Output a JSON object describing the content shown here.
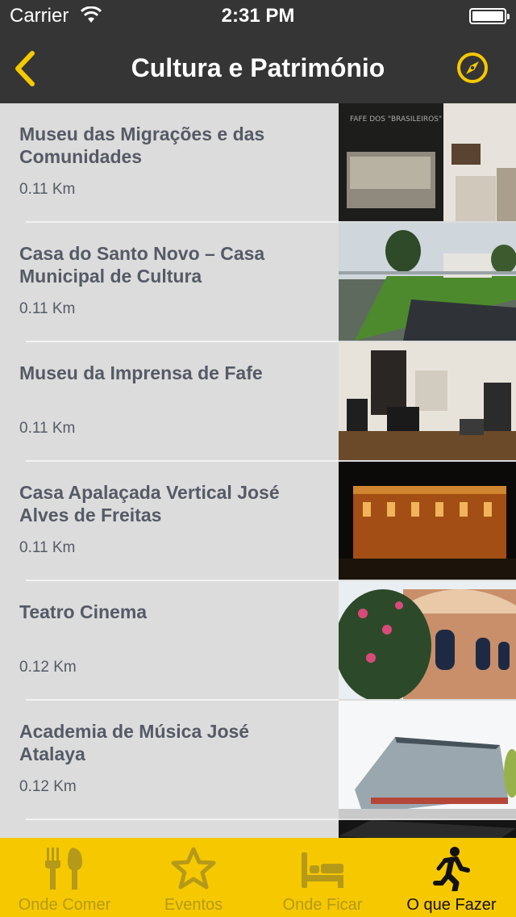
{
  "status": {
    "carrier": "Carrier",
    "time": "2:31 PM"
  },
  "nav": {
    "title": "Cultura e Património"
  },
  "colors": {
    "accent": "#f6c800",
    "header": "#353535",
    "row_text": "#555a66",
    "inactive_tab": "#b59a1a"
  },
  "items": [
    {
      "title": "Museu das Migrações e das Comunidades",
      "distance": "0.11 Km"
    },
    {
      "title": "Casa do Santo Novo – Casa Municipal de Cultura",
      "distance": "0.11 Km"
    },
    {
      "title": "Museu da Imprensa de Fafe",
      "distance": "0.11 Km"
    },
    {
      "title": "Casa Apalaçada Vertical José Alves de Freitas",
      "distance": "0.11 Km"
    },
    {
      "title": "Teatro Cinema",
      "distance": "0.12 Km"
    },
    {
      "title": "Academia de Música José Atalaya",
      "distance": "0.12 Km"
    }
  ],
  "tabs": [
    {
      "label": "Onde Comer",
      "icon": "fork-knife-icon"
    },
    {
      "label": "Eventos",
      "icon": "star-icon"
    },
    {
      "label": "Onde Ficar",
      "icon": "bed-icon"
    },
    {
      "label": "O que Fazer",
      "icon": "walking-person-icon",
      "active": true
    }
  ]
}
